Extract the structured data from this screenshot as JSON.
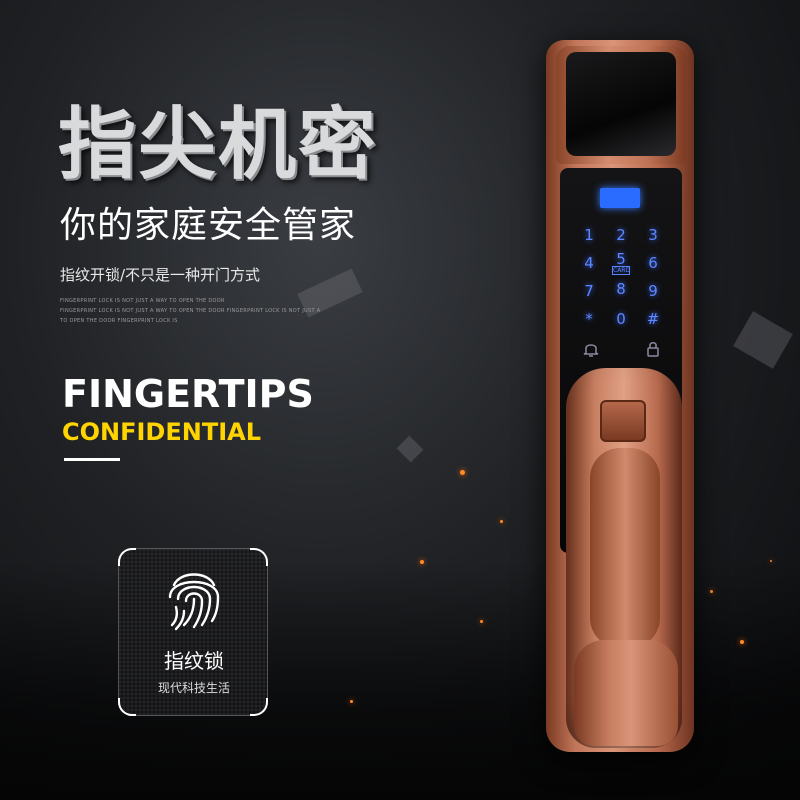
{
  "hero": {
    "headline": "指尖机密",
    "subheadline": "你的家庭安全管家",
    "tagline": "指纹开锁/不只是一种开门方式",
    "fineprint": [
      "FINGERPRINT LOCK IS NOT JUST A WAY TO OPEN THE DOOR",
      "FINGERPRINT LOCK IS NOT JUST A WAY TO OPEN THE DOOR FINGERPRINT LOCK IS NOT JUST A WAY",
      "TO OPEN THE DOOR FINGERPRINT LOCK IS"
    ],
    "title_en": "FINGERTIPS",
    "title_en_highlight": "CONFIDENTIAL"
  },
  "badge": {
    "icon": "fingerprint-icon",
    "title": "指纹锁",
    "subtitle": "现代科技生活"
  },
  "lock": {
    "keypad": [
      "1",
      "2",
      "3",
      "4",
      "5",
      "6",
      "7",
      "8",
      "9",
      "*",
      "0",
      "#"
    ],
    "card_label": "CARD",
    "icons": [
      "bell-icon",
      "padlock-icon"
    ]
  },
  "colors": {
    "accent_yellow": "#ffd400",
    "keypad_blue": "#5e86ff",
    "lock_copper": "#c98062"
  }
}
